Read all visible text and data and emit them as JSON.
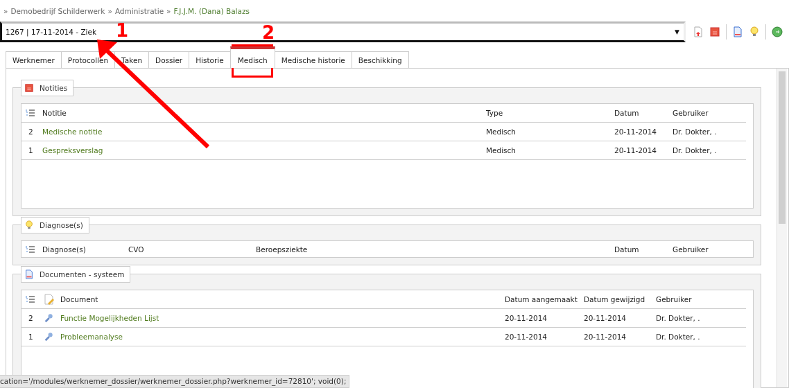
{
  "breadcrumb": [
    {
      "label": "Demobedrijf Schilderwerk",
      "current": false
    },
    {
      "label": "Administratie",
      "current": false
    },
    {
      "label": "F.J.J.M. (Dana) Balazs",
      "current": true
    }
  ],
  "breadcrumb_separator": "»",
  "case_selector": {
    "value": "1267 | 17-11-2014 - Ziek",
    "caret": "▼"
  },
  "tabs": [
    {
      "label": "Werknemer",
      "selected": false
    },
    {
      "label": "Protocollen",
      "selected": false
    },
    {
      "label": "Taken",
      "selected": false
    },
    {
      "label": "Dossier",
      "selected": false
    },
    {
      "label": "Historie",
      "selected": false
    },
    {
      "label": "Medisch",
      "selected": true
    },
    {
      "label": "Medische historie",
      "selected": false
    },
    {
      "label": "Beschikking",
      "selected": false
    }
  ],
  "notes": {
    "title": "Notities",
    "columns": [
      "Notitie",
      "Type",
      "Datum",
      "Gebruiker"
    ],
    "rows": [
      {
        "number": "2",
        "cells": [
          "Medische notitie",
          "Medisch",
          "20-11-2014",
          "Dr. Dokter, ."
        ]
      },
      {
        "number": "1",
        "cells": [
          "Gespreksverslag",
          "Medisch",
          "20-11-2014",
          "Dr. Dokter, ."
        ]
      }
    ]
  },
  "diagnoses": {
    "title": "Diagnose(s)",
    "columns": [
      "Diagnose(s)",
      "CVO",
      "Beroepsziekte",
      "Datum",
      "Gebruiker"
    ]
  },
  "documents": {
    "title": "Documenten - systeem",
    "columns": [
      "Document",
      "Datum aangemaakt",
      "Datum gewijzigd",
      "Gebruiker"
    ],
    "rows": [
      {
        "number": "2",
        "cells": [
          "Functie Mogelijkheden Lijst",
          "20-11-2014",
          "20-11-2014",
          "Dr. Dokter, ."
        ]
      },
      {
        "number": "1",
        "cells": [
          "Probleemanalyse",
          "20-11-2014",
          "20-11-2014",
          "Dr. Dokter, ."
        ]
      }
    ]
  },
  "status_bar": {
    "text": "cation='/modules/werknemer_dossier/werknemer_dossier.php?werknemer_id=72810'; void(0);"
  },
  "annotations": {
    "markers": [
      "1",
      "2"
    ]
  }
}
